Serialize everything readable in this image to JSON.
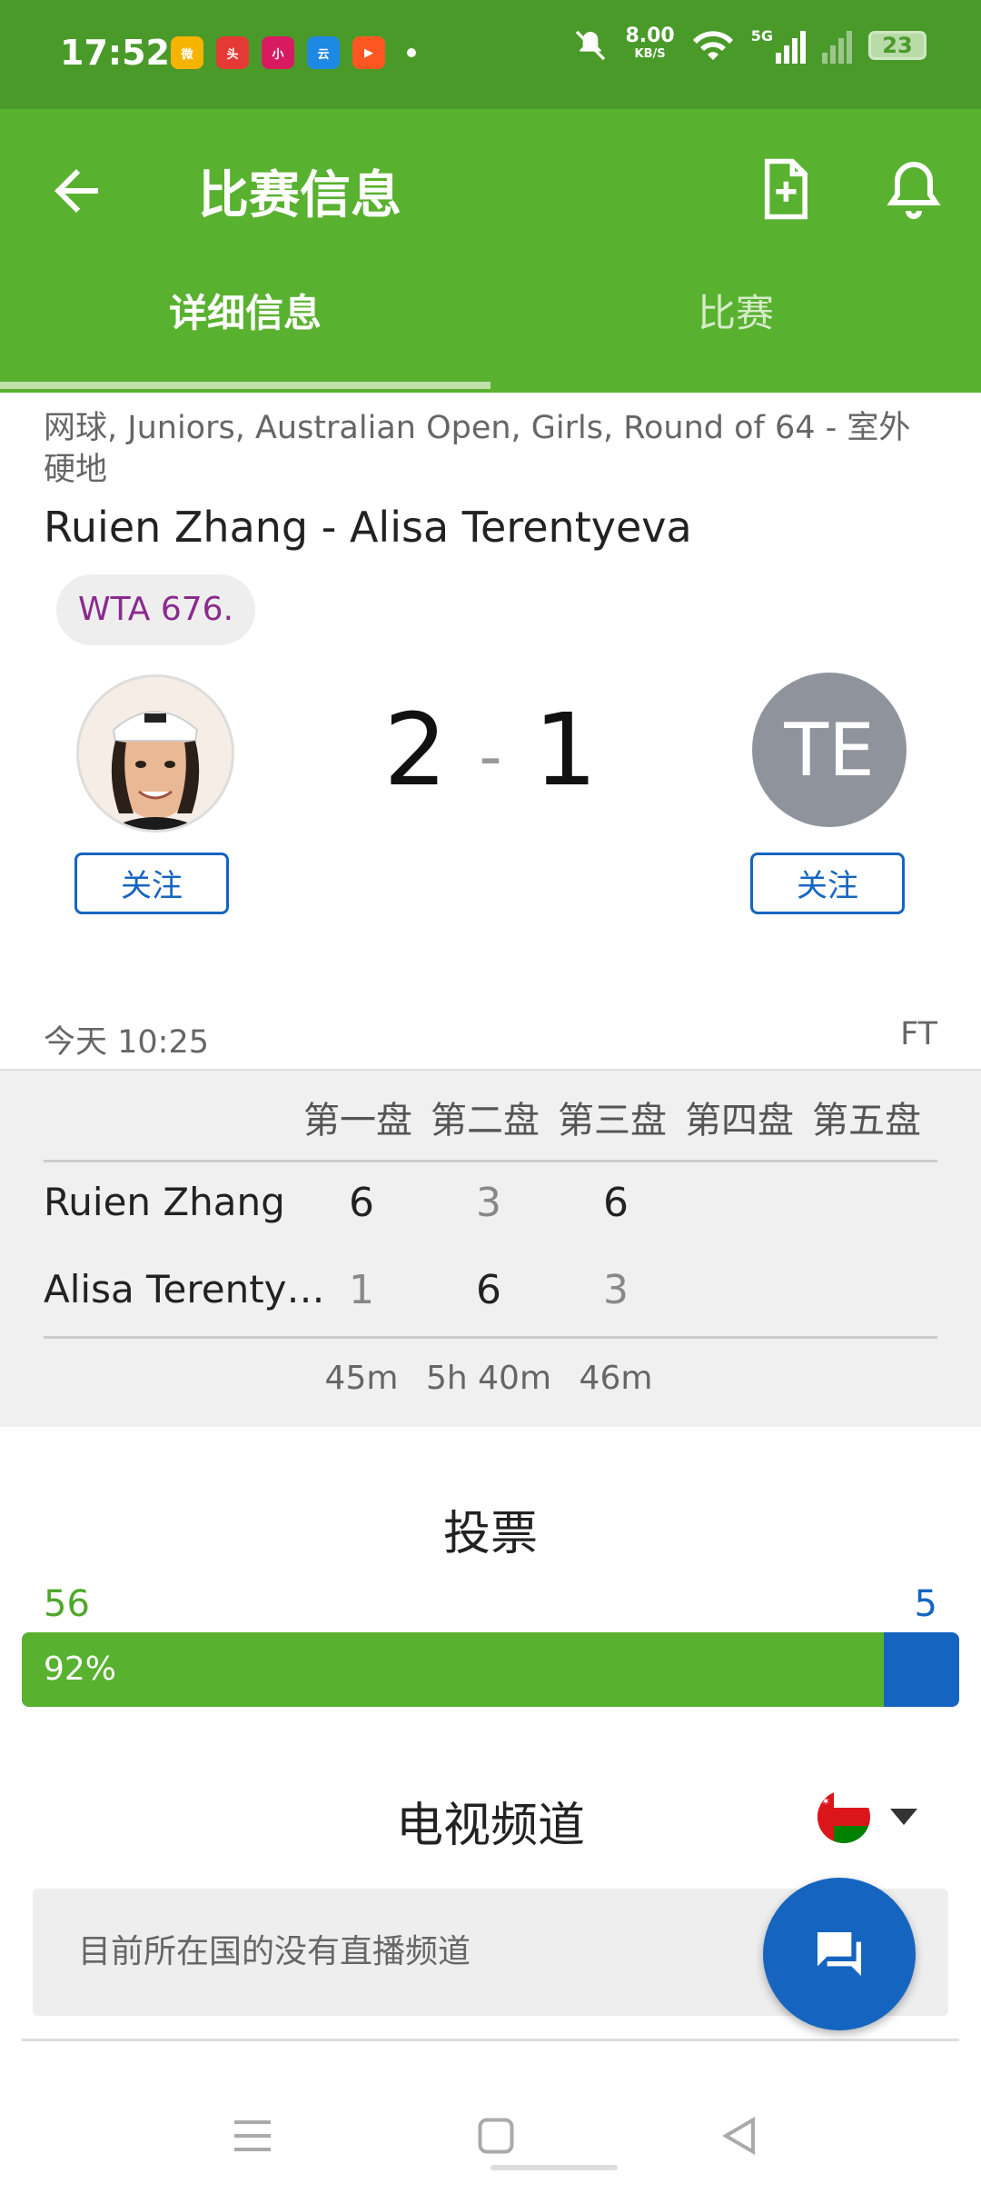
{
  "status_bar": {
    "time": "17:52",
    "apps": [
      "weibo",
      "toutiao",
      "xiaohongshu",
      "app4",
      "video"
    ],
    "net_speed": "8.00",
    "net_unit": "KB/S",
    "signal": "5G",
    "battery": "23"
  },
  "appbar": {
    "title": "比赛信息",
    "tabs": [
      {
        "label": "详细信息"
      },
      {
        "label": "比赛"
      }
    ]
  },
  "match": {
    "breadcrumb": "网球, Juniors, Australian Open, Girls, Round of 64 - 室外硬地",
    "title": "Ruien Zhang - Alisa Terentyeva",
    "rank": "WTA 676.",
    "score_home": "2",
    "score_sep": "-",
    "score_away": "1",
    "away_initials": "TE",
    "follow_label": "关注",
    "when": "今天 10:25",
    "status": "FT"
  },
  "sets": {
    "headers": [
      "第一盘",
      "第二盘",
      "第三盘",
      "第四盘",
      "第五盘"
    ],
    "rows": [
      {
        "name": "Ruien Zhang",
        "scores": [
          "6",
          "3",
          "6"
        ]
      },
      {
        "name": "Alisa Terenty…",
        "scores": [
          "1",
          "6",
          "3"
        ]
      }
    ],
    "durations": [
      "45m",
      "5h 40m",
      "46m"
    ]
  },
  "vote": {
    "title": "投票",
    "home": "56",
    "away": "5",
    "home_pct_label": "92%",
    "home_fraction": 0.92
  },
  "tv": {
    "title": "电视频道",
    "message": "目前所在国的没有直播频道"
  },
  "colors": {
    "statusbar": "#4a9a2a",
    "appbar": "#59b130",
    "accent_blue": "#1565c0",
    "rank_purple": "#8a2a8e"
  }
}
